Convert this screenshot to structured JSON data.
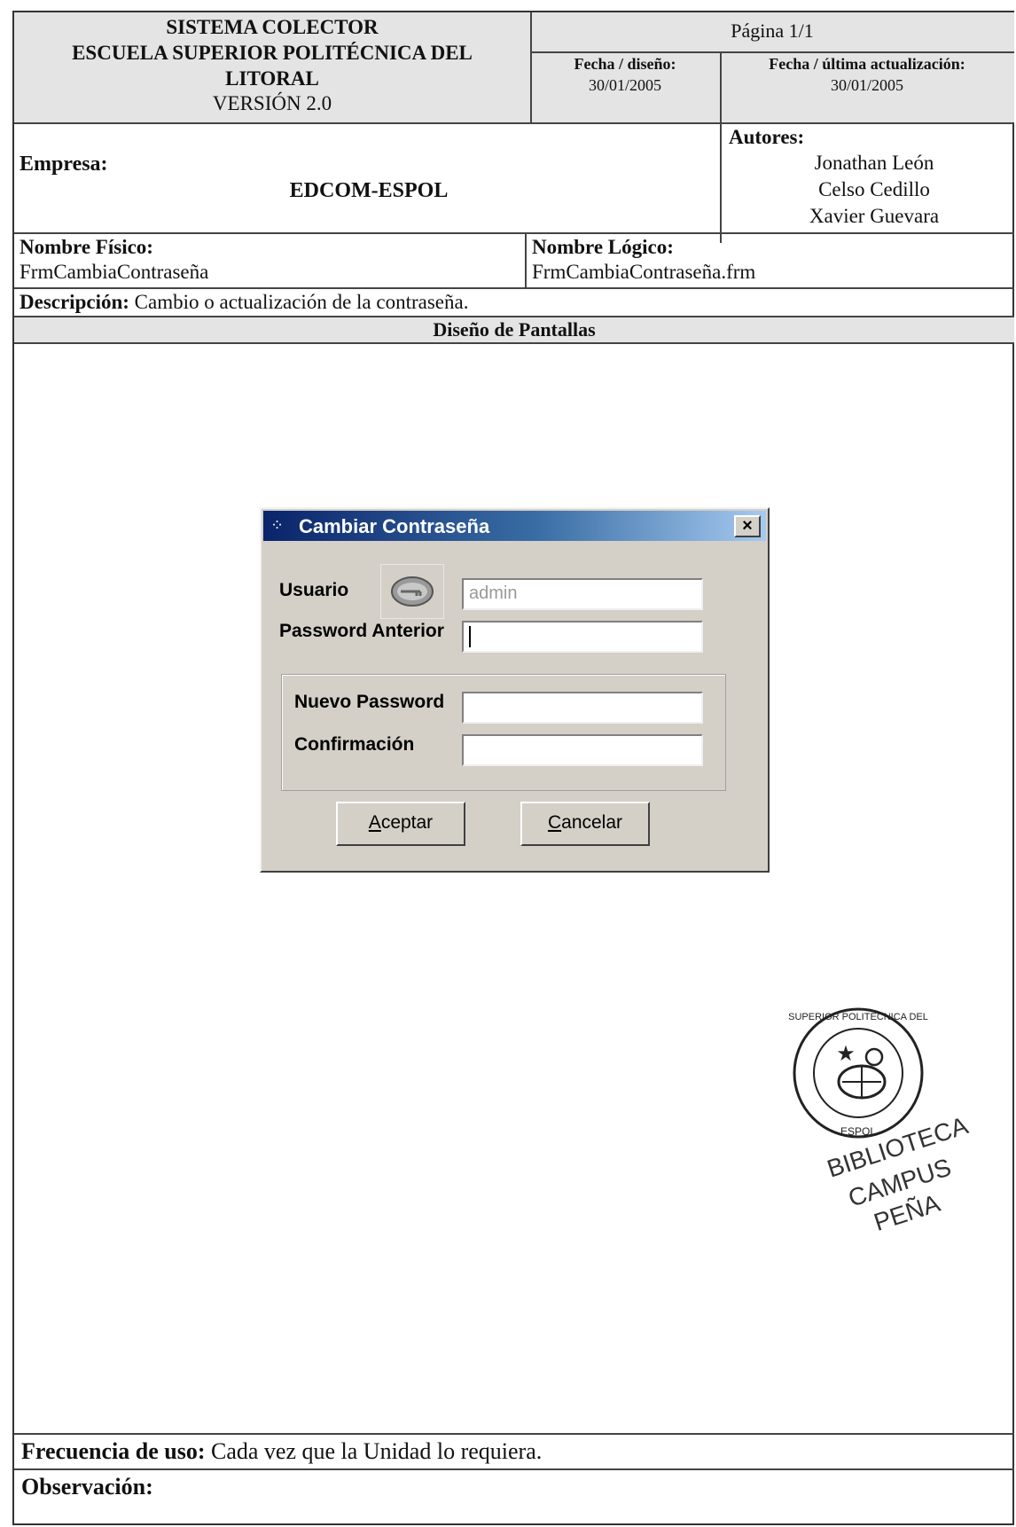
{
  "header": {
    "system_line1": "SISTEMA COLECTOR",
    "system_line2": "ESCUELA SUPERIOR POLITÉCNICA DEL",
    "system_line3": "LITORAL",
    "version": "VERSIÓN 2.0",
    "page": "Página 1/1",
    "fecha_diseno_label": "Fecha / diseño:",
    "fecha_diseno": "30/01/2005",
    "fecha_actualizacion_label": "Fecha / última actualización:",
    "fecha_actualizacion": "30/01/2005"
  },
  "empresa": {
    "label": "Empresa:",
    "value": "EDCOM-ESPOL"
  },
  "autores": {
    "label": "Autores:",
    "names": [
      "Jonathan León",
      "Celso Cedillo",
      "Xavier Guevara"
    ]
  },
  "nombres": {
    "fisico_label": "Nombre Físico:",
    "fisico": "FrmCambiaContraseña",
    "logico_label": "Nombre Lógico:",
    "logico": "FrmCambiaContraseña.frm"
  },
  "descripcion": {
    "label": "Descripción:",
    "text": "Cambio o actualización de la contraseña."
  },
  "section_title": "Diseño de Pantallas",
  "dialog": {
    "title": "Cambiar Contraseña",
    "close": "×",
    "usuario_label": "Usuario",
    "usuario_value": "admin",
    "password_anterior_label": "Password Anterior",
    "nuevo_password_label": "Nuevo Password",
    "confirmacion_label": "Confirmación",
    "aceptar_mnemonic": "A",
    "aceptar_rest": "ceptar",
    "cancelar_mnemonic": "C",
    "cancelar_rest": "ancelar"
  },
  "stamp": {
    "ring_text": "ESCUELA SUPERIOR POLITÉCNICA DEL LITORAL ESPOL",
    "line1": "BIBLIOTECA",
    "line2": "CAMPUS",
    "line3": "PEÑA"
  },
  "frecuencia": {
    "label": "Frecuencia de uso:",
    "text": "Cada vez que la Unidad lo requiera."
  },
  "observacion": {
    "label": "Observación:"
  }
}
